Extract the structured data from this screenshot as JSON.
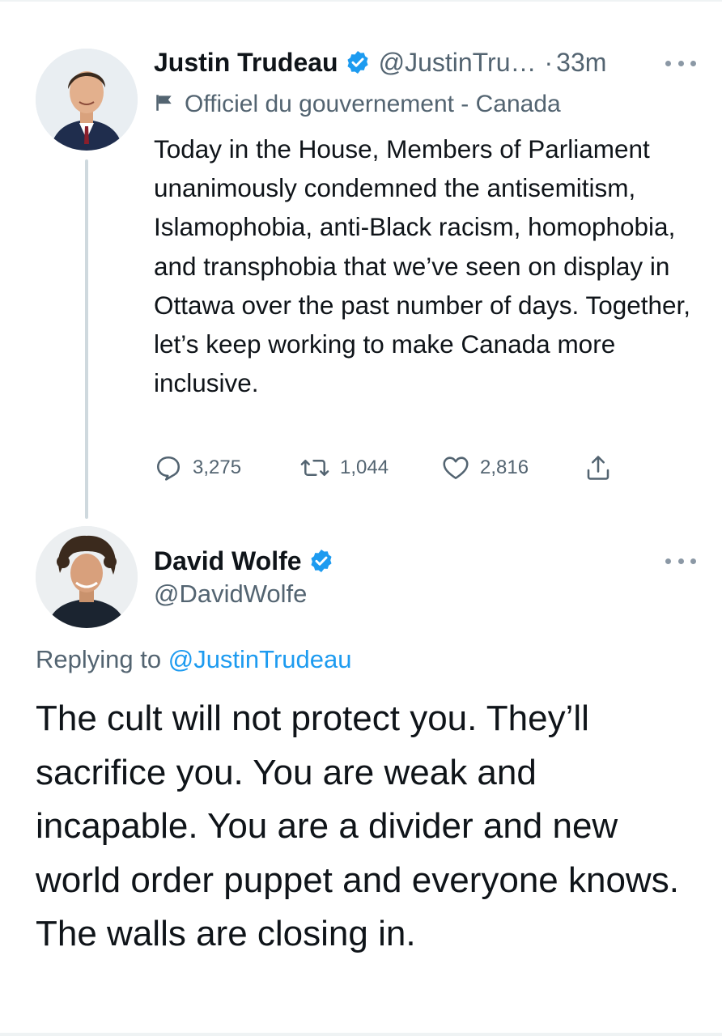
{
  "colors": {
    "text_primary": "#0f1419",
    "text_secondary": "#536471",
    "link": "#1d9bf0",
    "verified_badge": "#1d9bf0",
    "thread_line": "#cfd9de"
  },
  "parent_tweet": {
    "author_name": "Justin Trudeau",
    "author_handle": "@JustinTru…",
    "separator": "·",
    "timestamp": "33m",
    "label_icon": "flag-icon",
    "label": "Officiel du gouvernement - Canada",
    "text": "Today in the House, Members of Parliament unanimously condemned the antisemitism, Islamophobia, anti-Black racism, homophobia, and transphobia that we’ve seen on display in Ottawa over the past number of days. Together, let’s keep working to make Canada more inclusive.",
    "replies_count": "3,275",
    "retweets_count": "1,044",
    "likes_count": "2,816"
  },
  "reply_tweet": {
    "author_name": "David Wolfe",
    "author_handle": "@DavidWolfe",
    "replying_prefix": "Replying to",
    "replying_to": "@JustinTrudeau",
    "text": "The cult will not protect you. They’ll sacrifice you. You are weak and incapable. You are a divider and new world order puppet and everyone knows. The walls are closing in."
  }
}
